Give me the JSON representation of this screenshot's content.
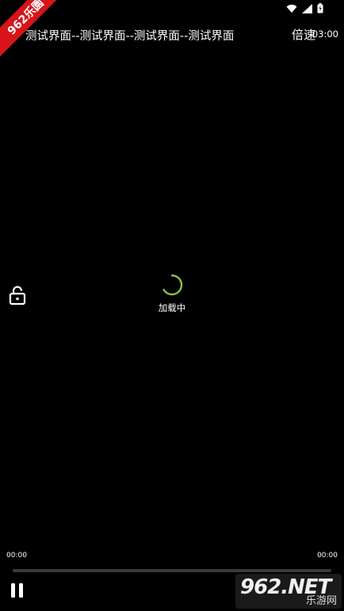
{
  "status_bar": {
    "icons": [
      "wifi-icon",
      "signal-icon",
      "battery-icon"
    ]
  },
  "badge": {
    "text": "962乐園"
  },
  "top_bar": {
    "title": "测试界面--测试界面--测试界面--测试界面",
    "speed_label": "倍速",
    "duration": "03:00"
  },
  "player": {
    "loading_text": "加载中",
    "lock_icon": "unlock-icon",
    "current_time": "00:00",
    "total_time": "00:00",
    "progress": 0,
    "pause_icon": "pause-icon"
  },
  "watermark": {
    "main": "962.NET",
    "sub": "乐游网"
  },
  "colors": {
    "background": "#000000",
    "spinner": "#8bc34a",
    "badge": "#d8141b"
  }
}
